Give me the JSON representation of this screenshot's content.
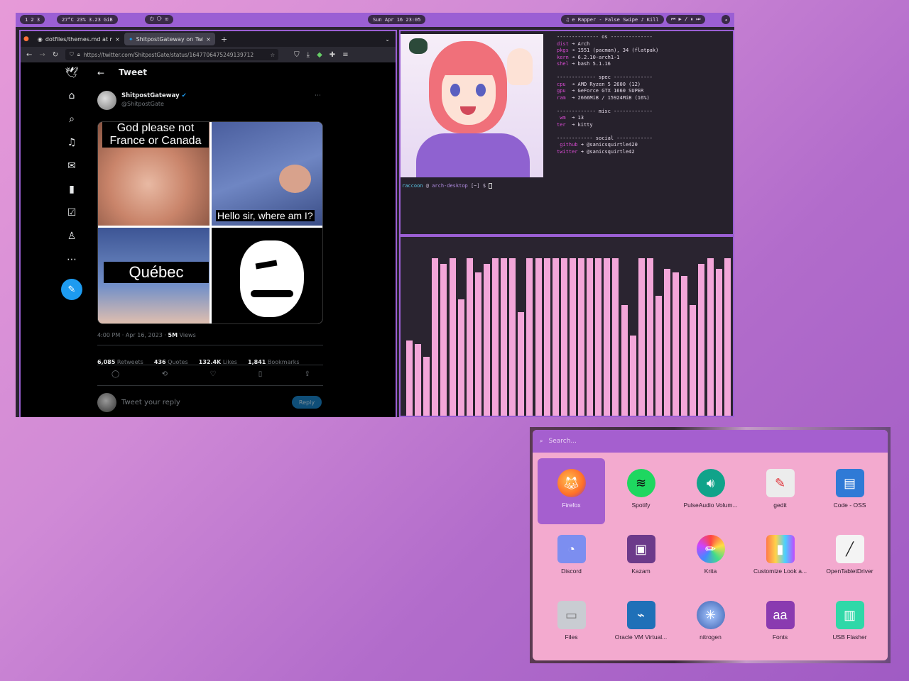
{
  "topbar": {
    "workspaces": "1  2  3",
    "sysinfo": "27°C   23%   3.23 GiB",
    "power": "⏻  ⟳  ⊡",
    "clock": "Sun Apr 16 23:05",
    "media": "♫ e Rapper - False Swipe ♪ Kill",
    "media_controls": "⏮ ▶ / ⏸ ⏭"
  },
  "browser": {
    "tab1": "dotfiles/themes.md at ma",
    "tab2": "ShitpostGateway on Twitte",
    "url": "https://twitter.com/ShitpostGate/status/1647706475249139712"
  },
  "tweet": {
    "header": "Tweet",
    "name": "ShitpostGateway",
    "handle": "@ShitpostGate",
    "meme_top": "God please not France or Canada",
    "meme_reply": "Hello sir, where am I?",
    "meme_place": "Québec",
    "time": "4:00 PM · Apr 16, 2023 ·",
    "views_count": "5M",
    "views_label": "Views",
    "retweets": "6,085",
    "retweets_label": "Retweets",
    "quotes": "436",
    "quotes_label": "Quotes",
    "likes": "132.4K",
    "likes_label": "Likes",
    "bookmarks": "1,841",
    "bookmarks_label": "Bookmarks",
    "reply_placeholder": "Tweet your reply",
    "reply_button": "Reply"
  },
  "terminal": {
    "os_header": "-------------- os --------------",
    "dist": "Arch",
    "pkgs": "1551 (pacman), 34 (flatpak)",
    "kern": "6.2.10-arch1-1",
    "shell": "bash 5.1.16",
    "spec_header": "------------- spec -------------",
    "cpu": "AMD Ryzen 5 2600 (12)",
    "gpu": "GeForce GTX 1660 SUPER",
    "ram": "2666MiB / 15924MiB (16%)",
    "misc_header": "------------- misc -------------",
    "wm": "13",
    "ter": "kitty",
    "social_header": "------------ social ------------",
    "github": "@sanicsquirtle420",
    "twitter": "@sanicsquirtle42",
    "prompt_user": "raccoon",
    "prompt_host": "arch-desktop",
    "prompt_tail": "[~] $"
  },
  "visualizer": {
    "bars": [
      0.42,
      0.4,
      0.33,
      0.88,
      0.85,
      0.88,
      0.65,
      0.88,
      0.8,
      0.85,
      0.88,
      0.88,
      0.88,
      0.58,
      0.88,
      0.88,
      0.88,
      0.88,
      0.88,
      0.88,
      0.88,
      0.88,
      0.88,
      0.88,
      0.88,
      0.62,
      0.45,
      0.88,
      0.88,
      0.67,
      0.82,
      0.8,
      0.78,
      0.62,
      0.85,
      0.88,
      0.82,
      0.88
    ]
  },
  "launcher": {
    "search_placeholder": "Search...",
    "apps": [
      {
        "label": "Firefox"
      },
      {
        "label": "Spotify"
      },
      {
        "label": "PulseAudio Volum..."
      },
      {
        "label": "gedit"
      },
      {
        "label": "Code - OSS"
      },
      {
        "label": "Discord"
      },
      {
        "label": "Kazam"
      },
      {
        "label": "Krita"
      },
      {
        "label": "Customize Look a..."
      },
      {
        "label": "OpenTabletDriver"
      },
      {
        "label": "Files"
      },
      {
        "label": "Oracle VM Virtual..."
      },
      {
        "label": "nitrogen"
      },
      {
        "label": "Fonts"
      },
      {
        "label": "USB Flasher"
      }
    ]
  }
}
